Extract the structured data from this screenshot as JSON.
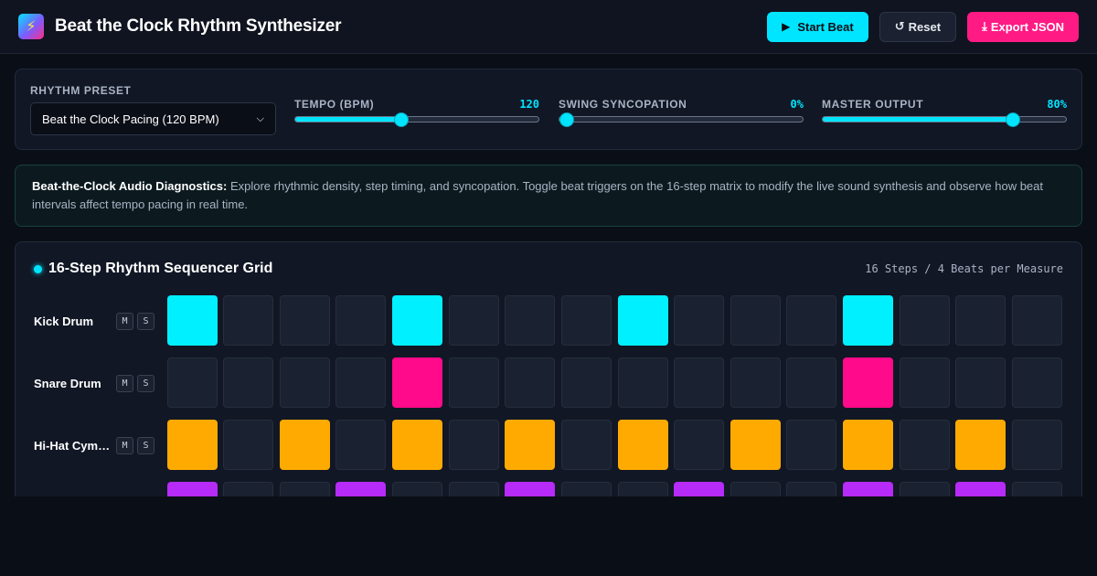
{
  "header": {
    "title": "Beat the Clock Rhythm Synthesizer",
    "logo_icon": "lightning-icon",
    "start_label": "Start Beat",
    "reset_label": "Reset",
    "export_label": "Export JSON"
  },
  "controls": {
    "preset_label": "RHYTHM PRESET",
    "preset_value": "Beat the Clock Pacing (120 BPM)",
    "sliders": [
      {
        "label": "TEMPO (BPM)",
        "display": "120",
        "fraction": 0.43
      },
      {
        "label": "SWING SYNCOPATION",
        "display": "0%",
        "fraction": 0.0
      },
      {
        "label": "MASTER OUTPUT",
        "display": "80%",
        "fraction": 0.8
      }
    ]
  },
  "info": {
    "lead": "Beat-the-Clock Audio Diagnostics:",
    "text": " Explore rhythmic density, step timing, and syncopation. Toggle beat triggers on the 16-step matrix to modify the live sound synthesis and observe how beat intervals affect tempo pacing in real time."
  },
  "sequencer": {
    "title": "16-Step Rhythm Sequencer Grid",
    "meta": "16 Steps / 4 Beats per Measure",
    "mute_label": "M",
    "solo_label": "S",
    "tracks": [
      {
        "name": "Kick Drum",
        "color": "#00f0ff",
        "steps": [
          1,
          0,
          0,
          0,
          1,
          0,
          0,
          0,
          1,
          0,
          0,
          0,
          1,
          0,
          0,
          0
        ]
      },
      {
        "name": "Snare Drum",
        "color": "#ff0a8a",
        "steps": [
          0,
          0,
          0,
          0,
          1,
          0,
          0,
          0,
          0,
          0,
          0,
          0,
          1,
          0,
          0,
          0
        ]
      },
      {
        "name": "Hi-Hat Cym…",
        "color": "#ffaa00",
        "steps": [
          1,
          0,
          1,
          0,
          1,
          0,
          1,
          0,
          1,
          0,
          1,
          0,
          1,
          0,
          1,
          0
        ]
      },
      {
        "name": "",
        "color": "#b62bf8",
        "steps": [
          1,
          0,
          0,
          1,
          0,
          0,
          1,
          0,
          0,
          1,
          0,
          0,
          1,
          0,
          1,
          0
        ]
      }
    ]
  }
}
